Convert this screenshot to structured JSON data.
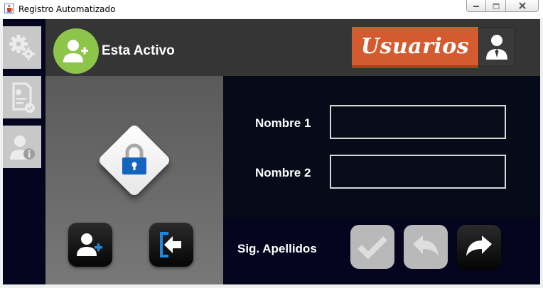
{
  "window": {
    "title": "Registro Automatizado",
    "icon": "java-cup-icon",
    "controls": [
      "minimize",
      "maximize",
      "close"
    ]
  },
  "sidebar": {
    "items": [
      {
        "name": "settings",
        "icon": "gears-icon"
      },
      {
        "name": "report",
        "icon": "document-check-icon"
      },
      {
        "name": "user-info",
        "icon": "user-info-icon"
      }
    ]
  },
  "header": {
    "status_text": "Esta Activo",
    "status_icon": "add-user-icon",
    "status_color": "#8cc54a",
    "section_title": "Usuarios",
    "section_color": "#d45a30",
    "section_icon": "businessman-icon"
  },
  "form": {
    "fields": [
      {
        "label": "Nombre 1",
        "value": ""
      },
      {
        "label": "Nombre 2",
        "value": ""
      }
    ]
  },
  "lock": {
    "icon": "padlock-icon",
    "color": "#1565c0"
  },
  "actions": {
    "add_user_icon": "add-user-icon",
    "exit_icon": "exit-arrow-icon",
    "next_label": "Sig. Apellidos",
    "confirm_icon": "checkmark-icon",
    "back_icon": "undo-arrow-icon",
    "forward_icon": "redo-arrow-icon"
  }
}
